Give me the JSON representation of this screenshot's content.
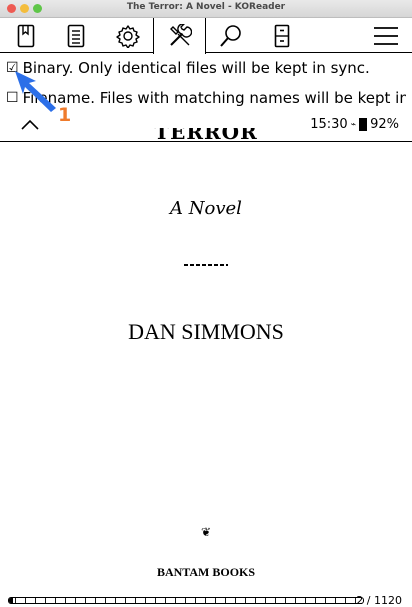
{
  "window": {
    "title": "The Terror: A Novel - KOReader"
  },
  "toolbar": {
    "tabs": [
      {
        "name": "bookmark",
        "icon": "bookmark-icon"
      },
      {
        "name": "toc",
        "icon": "table-of-contents-icon"
      },
      {
        "name": "settings",
        "icon": "gear-icon"
      },
      {
        "name": "tools",
        "icon": "tools-icon",
        "active": true
      },
      {
        "name": "search",
        "icon": "search-icon"
      },
      {
        "name": "file-browser",
        "icon": "cabinet-icon"
      },
      {
        "name": "main-menu",
        "icon": "hamburger-icon"
      }
    ]
  },
  "menu": {
    "options": [
      {
        "checkbox": "☑",
        "label": "Binary. Only identical files will be kept in sync.",
        "checked": true
      },
      {
        "checkbox": "☐",
        "label": "Filename. Files with matching names will be kept in...",
        "checked": false
      }
    ]
  },
  "status": {
    "time": "15:30",
    "battery": "92%"
  },
  "annotation": {
    "number": "1",
    "color": "#ef7b2c",
    "arrow_color": "#2c6fe8"
  },
  "book": {
    "title_fragment": "TERROR",
    "subtitle": "A Novel",
    "author": "DAN SIMMONS",
    "publisher": "BANTAM BOOKS",
    "colophon_glyph": "❦"
  },
  "footer": {
    "page_count": "2 / 1120",
    "progress": 0.0018
  }
}
